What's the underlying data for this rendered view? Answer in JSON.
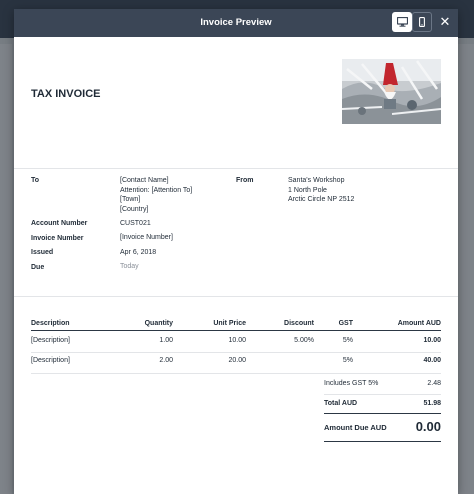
{
  "modal": {
    "title": "Invoice Preview",
    "close_label": "✕"
  },
  "invoice": {
    "doc_title": "TAX INVOICE",
    "to_label": "To",
    "to_lines": [
      "[Contact Name]",
      "Attention: [Attention To]",
      "[Town]",
      "[Country]"
    ],
    "from_label": "From",
    "from_lines": [
      "Santa's Workshop",
      "1 North Pole",
      "Arctic Circle NP 2512"
    ],
    "account_number_label": "Account Number",
    "account_number": "CUST021",
    "invoice_number_label": "Invoice Number",
    "invoice_number": "[Invoice Number]",
    "issued_label": "Issued",
    "issued": "Apr 6, 2018",
    "due_label": "Due",
    "due": "Today"
  },
  "table": {
    "headers": [
      "Description",
      "Quantity",
      "Unit Price",
      "Discount",
      "GST",
      "Amount AUD"
    ],
    "rows": [
      {
        "description": "[Description]",
        "quantity": "1.00",
        "unit_price": "10.00",
        "discount": "5.00%",
        "gst": "5%",
        "amount": "10.00"
      },
      {
        "description": "[Description]",
        "quantity": "2.00",
        "unit_price": "20.00",
        "discount": "",
        "gst": "5%",
        "amount": "40.00"
      }
    ]
  },
  "totals": {
    "gst_label": "Includes GST 5%",
    "gst_value": "2.48",
    "total_label": "Total AUD",
    "total_value": "51.98",
    "due_label": "Amount Due AUD",
    "due_value": "0.00"
  },
  "colors": {
    "header_bg": "#3b4656",
    "text": "#1f2a36"
  },
  "icons": {
    "desktop": "desktop-icon",
    "mobile": "mobile-icon",
    "close": "close-icon"
  }
}
